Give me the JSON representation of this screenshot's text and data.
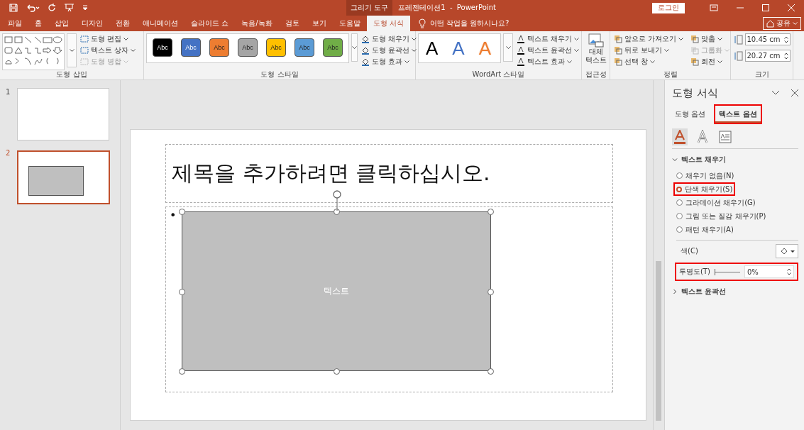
{
  "title_bar": {
    "context_tab": "그리기 도구",
    "title": "프레젠테이션1  -  PowerPoint",
    "login": "로그인"
  },
  "tabs": [
    {
      "label": "파일",
      "selected": false
    },
    {
      "label": "홈",
      "selected": false
    },
    {
      "label": "삽입",
      "selected": false
    },
    {
      "label": "디자인",
      "selected": false
    },
    {
      "label": "전환",
      "selected": false
    },
    {
      "label": "애니메이션",
      "selected": false
    },
    {
      "label": "슬라이드 쇼",
      "selected": false
    },
    {
      "label": "녹음/녹화",
      "selected": false
    },
    {
      "label": "검토",
      "selected": false
    },
    {
      "label": "보기",
      "selected": false
    },
    {
      "label": "도움말",
      "selected": false
    },
    {
      "label": "도형 서식",
      "selected": true
    }
  ],
  "tell_me": {
    "placeholder": "어떤 작업을 원하시나요?"
  },
  "share": "공유",
  "ribbon": {
    "insert_shapes": {
      "label": "도형 삽입",
      "commands": [
        {
          "label": "도형 편집",
          "disabled": false
        },
        {
          "label": "텍스트 상자",
          "disabled": false
        },
        {
          "label": "도형 병합",
          "disabled": true
        }
      ]
    },
    "shape_styles": {
      "label": "도형 스타일",
      "swatches": [
        {
          "label": "Abc",
          "color": "#000000"
        },
        {
          "label": "Abc",
          "color": "#4472c4"
        },
        {
          "label": "Abc",
          "color": "#ed7d31"
        },
        {
          "label": "Abc",
          "color": "#a5a5a5"
        },
        {
          "label": "Abc",
          "color": "#ffc000"
        },
        {
          "label": "Abc",
          "color": "#5b9bd5"
        },
        {
          "label": "Abc",
          "color": "#70ad47"
        }
      ],
      "commands": [
        {
          "label": "도형 채우기"
        },
        {
          "label": "도형 윤곽선"
        },
        {
          "label": "도형 효과"
        }
      ]
    },
    "wordart": {
      "label": "WordArt 스타일",
      "styles": [
        {
          "label": "A",
          "kind": "solid",
          "color": "#000000"
        },
        {
          "label": "A",
          "kind": "solid",
          "color": "#4472c4"
        },
        {
          "label": "A",
          "kind": "outline",
          "color": "#ed7d31"
        }
      ],
      "commands": [
        {
          "label": "텍스트 채우기"
        },
        {
          "label": "텍스트 윤곽선"
        },
        {
          "label": "텍스트 효과"
        }
      ]
    },
    "accessibility": {
      "label": "접근성",
      "button": "대체\n텍스트"
    },
    "arrange": {
      "label": "정렬",
      "commands": [
        {
          "label": "앞으로 가져오기",
          "disabled": false
        },
        {
          "label": "맞춤",
          "disabled": false
        },
        {
          "label": "뒤로 보내기",
          "disabled": false
        },
        {
          "label": "그룹화",
          "disabled": true
        },
        {
          "label": "선택 창",
          "disabled": false
        },
        {
          "label": "회전",
          "disabled": false
        }
      ]
    },
    "size": {
      "label": "크기",
      "fields": [
        {
          "value": "10.45 cm"
        },
        {
          "value": "20.27 cm"
        }
      ]
    }
  },
  "slides": [
    {
      "number": "1",
      "selected": false,
      "kind": "blank"
    },
    {
      "number": "2",
      "selected": true,
      "kind": "shape"
    }
  ],
  "slide": {
    "title": "제목을 추가하려면 클릭하십시오.",
    "bullet": "•",
    "shape_text": "텍스트"
  },
  "format_pane": {
    "title": "도형 서식",
    "tabs": [
      {
        "label": "도형 옵션",
        "selected": false,
        "highlighted": false
      },
      {
        "label": "텍스트 옵션",
        "selected": true,
        "highlighted": true
      }
    ],
    "icons": [
      {
        "kind": "fill",
        "selected": true
      },
      {
        "kind": "outline",
        "selected": false
      },
      {
        "kind": "textbox",
        "selected": false
      }
    ],
    "sections": [
      {
        "label": "텍스트 채우기",
        "expanded": true
      },
      {
        "label": "텍스트 윤곽선",
        "expanded": false
      }
    ],
    "fill_options": [
      {
        "label": "채우기 없음(N)",
        "selected": false,
        "highlighted": false
      },
      {
        "label": "단색 채우기(S)",
        "selected": true,
        "highlighted": true
      },
      {
        "label": "그라데이션 채우기(G)",
        "selected": false,
        "highlighted": false
      },
      {
        "label": "그림 또는 질감 채우기(P)",
        "selected": false,
        "highlighted": false
      },
      {
        "label": "패턴 채우기(A)",
        "selected": false,
        "highlighted": false
      }
    ],
    "color_label": "색(C)",
    "transparency": {
      "label": "투명도(T)",
      "level": 0,
      "value": "0%",
      "highlighted": true
    }
  }
}
